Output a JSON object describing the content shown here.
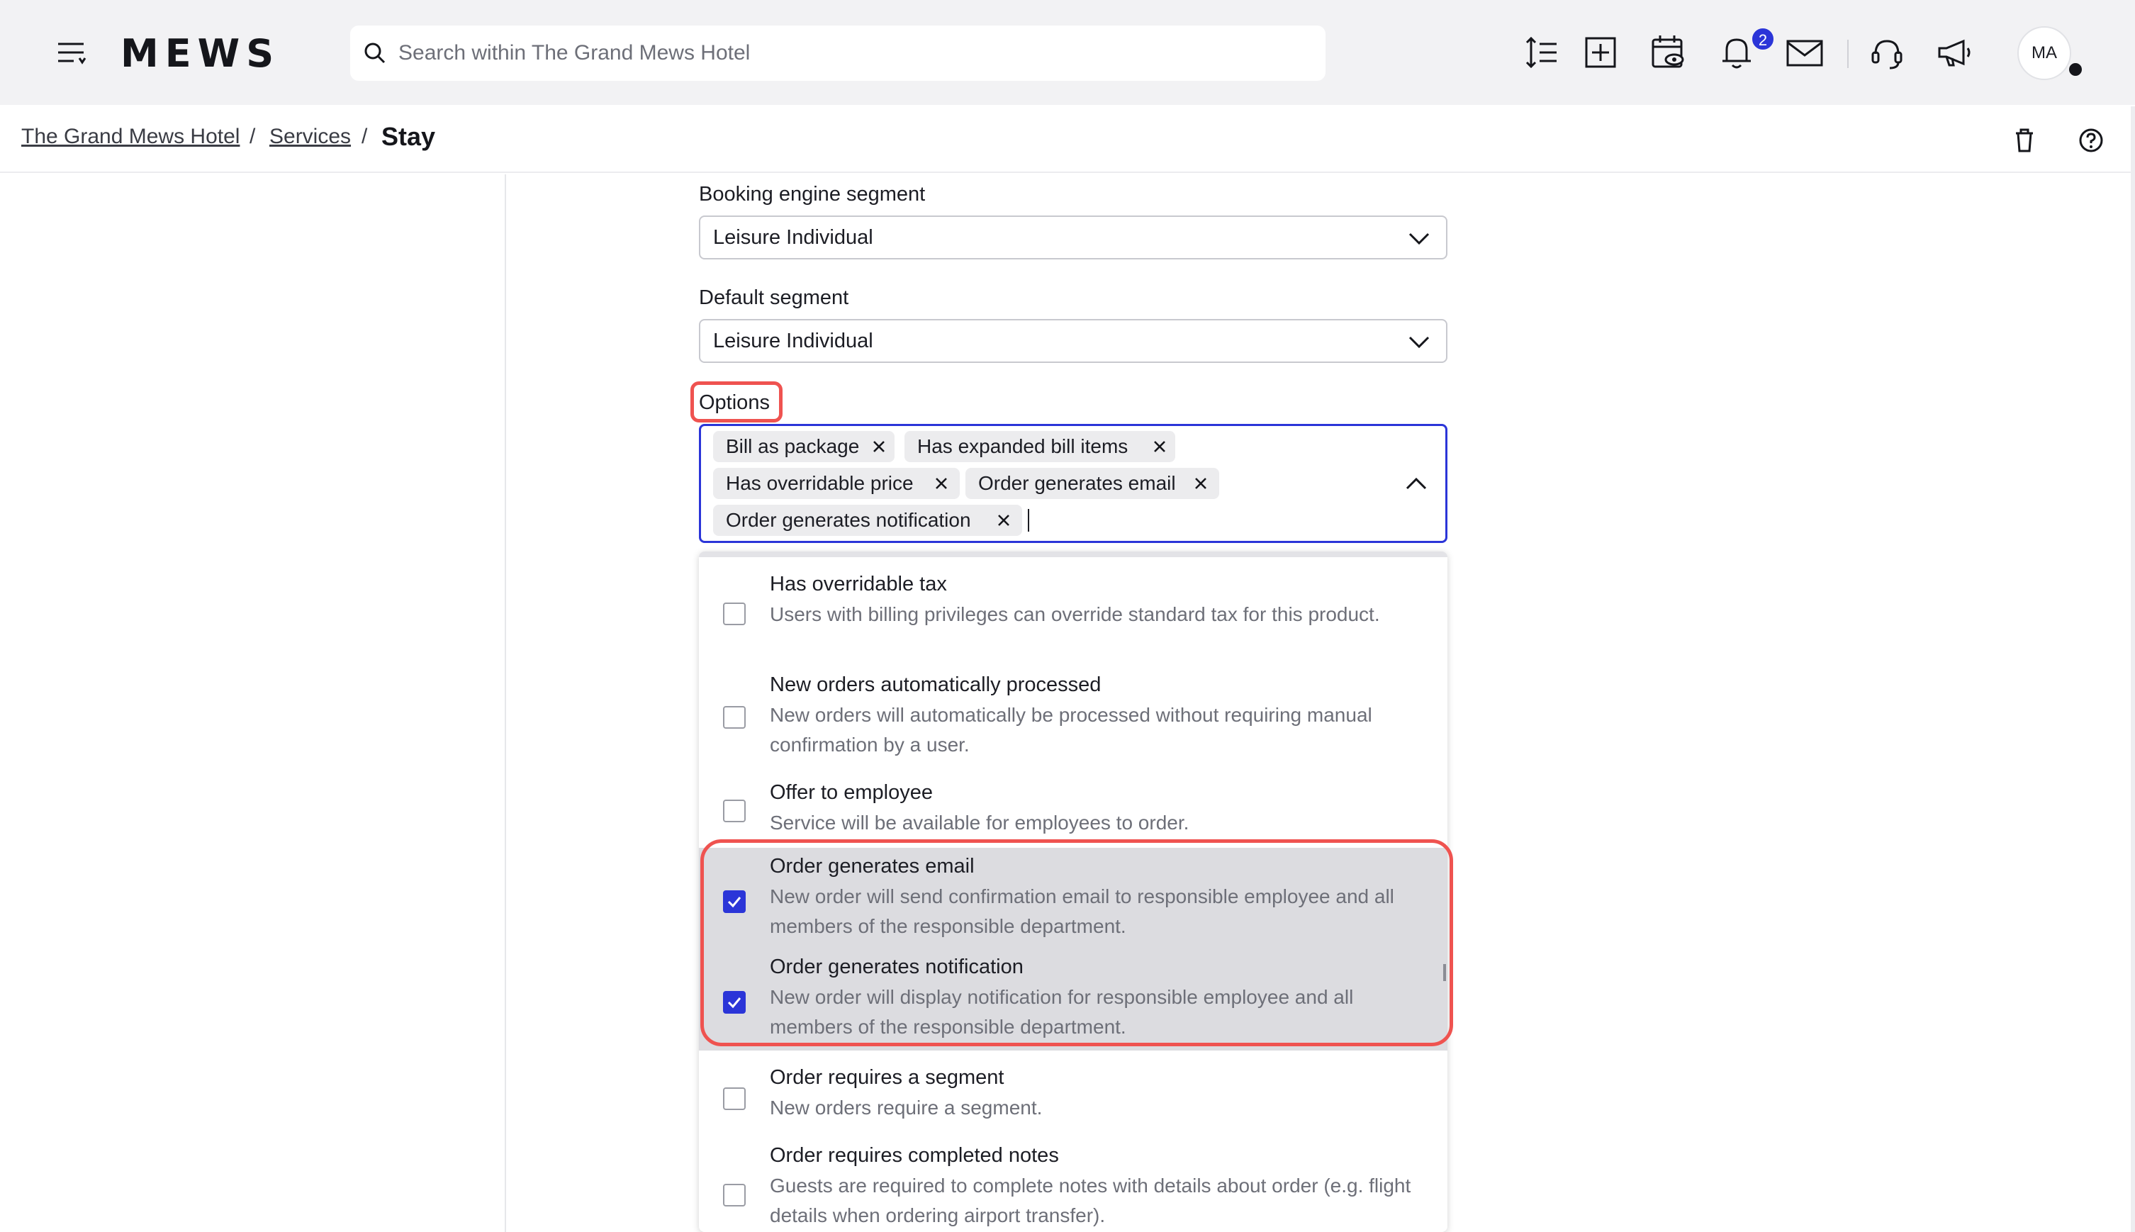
{
  "topbar": {
    "logo": "MEWS",
    "search_placeholder": "Search within The Grand Mews Hotel",
    "notification_count": "2",
    "avatar_initials": "MA"
  },
  "breadcrumb": {
    "items": [
      "The Grand Mews Hotel",
      "Services"
    ],
    "current": "Stay"
  },
  "form": {
    "booking_engine_segment": {
      "label": "Booking engine segment",
      "value": "Leisure Individual"
    },
    "default_segment": {
      "label": "Default segment",
      "value": "Leisure Individual"
    },
    "options": {
      "label": "Options",
      "selected_chips": [
        "Bill as package",
        "Has expanded bill items",
        "Has overridable price",
        "Order generates email",
        "Order generates notification"
      ],
      "dropdown_items": [
        {
          "title": "Has overridable tax",
          "description": "Users with billing privileges can override standard tax for this product.",
          "checked": false
        },
        {
          "title": "New orders automatically processed",
          "description": "New orders will automatically be processed without requiring manual confirmation by a user.",
          "checked": false
        },
        {
          "title": "Offer to employee",
          "description": "Service will be available for employees to order.",
          "checked": false
        },
        {
          "title": "Order generates email",
          "description": "New order will send confirmation email to responsible employee and all members of the responsible department.",
          "checked": true
        },
        {
          "title": "Order generates notification",
          "description": "New order will display notification for responsible employee and all members of the responsible department.",
          "checked": true
        },
        {
          "title": "Order requires a segment",
          "description": "New orders require a segment.",
          "checked": false
        },
        {
          "title": "Order requires completed notes",
          "description": "Guests are required to complete notes with details about order (e.g. flight details when ordering airport transfer).",
          "checked": false
        }
      ]
    }
  },
  "colors": {
    "accent": "#2b35d8",
    "highlight": "#ef5350",
    "selected_row": "#dcdce0"
  }
}
